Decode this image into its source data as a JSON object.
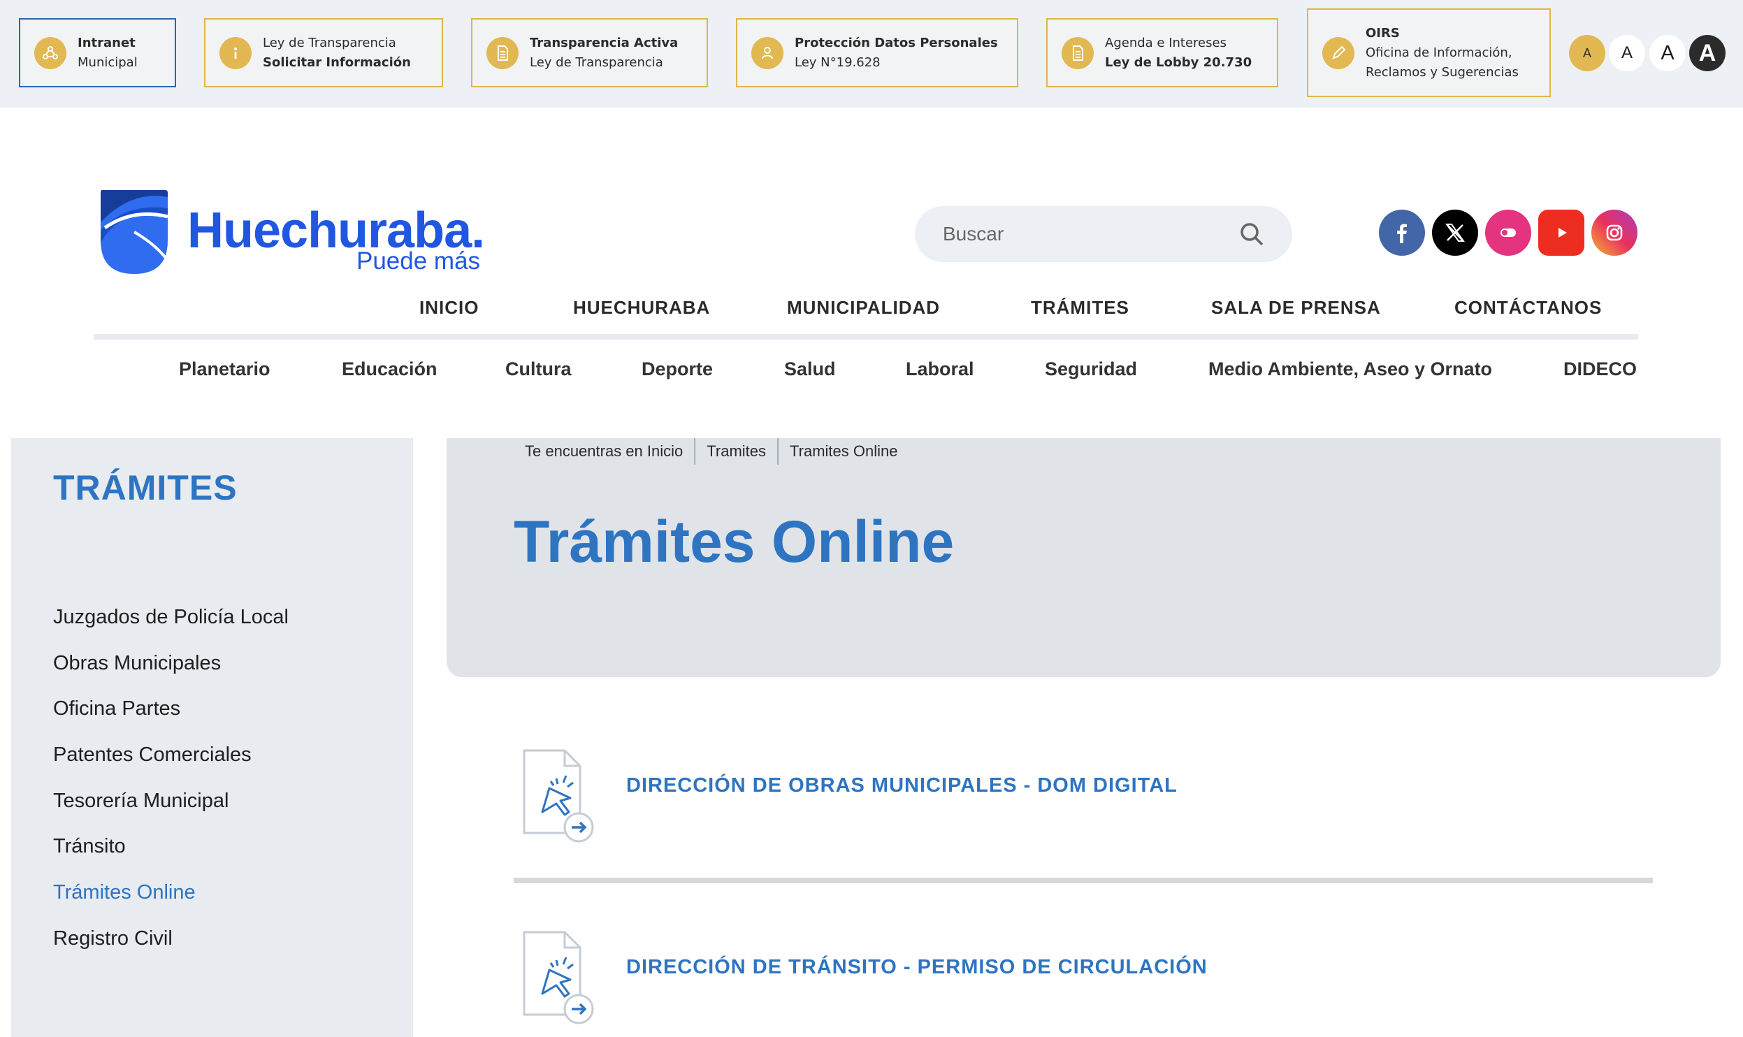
{
  "topbar": {
    "links": [
      {
        "line1": "Intranet",
        "line2": "Municipal",
        "icon": "network-icon"
      },
      {
        "line1": "Ley de Transparencia",
        "line2": "Solicitar Información",
        "icon": "info-icon"
      },
      {
        "line1": "Transparencia Activa",
        "line2": "Ley de Transparencia",
        "icon": "document-icon"
      },
      {
        "line1": "Protección Datos Personales",
        "line2": "Ley N°19.628",
        "icon": "user-icon"
      },
      {
        "line1": "Agenda e Intereses",
        "line2": "Ley de Lobby 20.730",
        "icon": "document-icon"
      },
      {
        "line1": "OIRS",
        "line2": "Oficina de Información,",
        "line3": "Reclamos y Sugerencias",
        "icon": "pencil-icon"
      }
    ],
    "font_size_buttons": [
      "A",
      "A",
      "A",
      "A"
    ],
    "accent_color": "#e2b852"
  },
  "header": {
    "logo_name": "Huechuraba.",
    "logo_tagline": "Puede más",
    "brand_color": "#2157e0",
    "search_placeholder": "Buscar",
    "social": [
      "facebook-icon",
      "x-icon",
      "flickr-icon",
      "youtube-icon",
      "instagram-icon"
    ]
  },
  "main_nav": [
    "INICIO",
    "HUECHURABA",
    "MUNICIPALIDAD",
    "TRÁMITES",
    "SALA DE PRENSA",
    "CONTÁCTANOS"
  ],
  "sub_nav": [
    "Planetario",
    "Educación",
    "Cultura",
    "Deporte",
    "Salud",
    "Laboral",
    "Seguridad",
    "Medio Ambiente, Aseo y Ornato",
    "DIDECO"
  ],
  "sidebar": {
    "title": "TRÁMITES",
    "items": [
      "Juzgados de Policía Local",
      "Obras Municipales",
      "Oficina Partes",
      "Patentes Comerciales",
      "Tesorería Municipal",
      "Tránsito",
      "Trámites Online",
      "Registro Civil"
    ],
    "active_item": "Trámites Online"
  },
  "breadcrumb": [
    "Te encuentras en Inicio",
    "Tramites",
    "Tramites Online"
  ],
  "page_title": "Trámites Online",
  "tramites": [
    "DIRECCIÓN DE OBRAS MUNICIPALES - DOM DIGITAL",
    "DIRECCIÓN DE TRÁNSITO - PERMISO DE CIRCULACIÓN"
  ],
  "content_color": "#2e74c1"
}
